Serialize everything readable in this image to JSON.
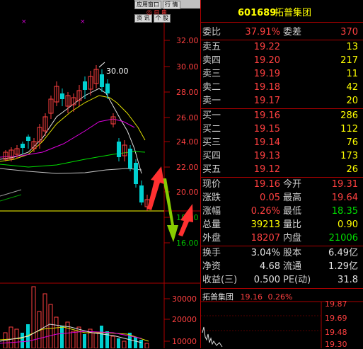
{
  "toolbar": {
    "buttons": [
      "应用窗口",
      "行 情",
      "资 讯",
      "个 股"
    ]
  },
  "price_axis": {
    "labels": [
      "32.00",
      "30.00",
      "28.00",
      "26.00",
      "24.00",
      "22.00",
      "20.00",
      "18.00",
      "16.00"
    ]
  },
  "volume_axis": {
    "labels": [
      "30000",
      "20000",
      "10000"
    ]
  },
  "annotation": {
    "peak_label": "30.00"
  },
  "quote": {
    "code": "601689",
    "name": "拓普集团",
    "committee": {
      "ratio_label": "委比",
      "ratio": "37.91%",
      "diff_label": "委差",
      "diff": "370"
    },
    "asks": [
      {
        "label": "卖五",
        "price": "19.22",
        "vol": "13"
      },
      {
        "label": "卖四",
        "price": "19.20",
        "vol": "217"
      },
      {
        "label": "卖三",
        "price": "19.19",
        "vol": "11"
      },
      {
        "label": "卖二",
        "price": "19.18",
        "vol": "42"
      },
      {
        "label": "卖一",
        "price": "19.17",
        "vol": "20"
      }
    ],
    "bids": [
      {
        "label": "买一",
        "price": "19.16",
        "vol": "286"
      },
      {
        "label": "买二",
        "price": "19.15",
        "vol": "112"
      },
      {
        "label": "买三",
        "price": "19.14",
        "vol": "76"
      },
      {
        "label": "买四",
        "price": "19.13",
        "vol": "173"
      },
      {
        "label": "买五",
        "price": "19.12",
        "vol": "26"
      }
    ],
    "stats": [
      {
        "l1": "现价",
        "v1": "19.16",
        "c1": "red",
        "l2": "今开",
        "v2": "19.31",
        "c2": "red"
      },
      {
        "l1": "涨跌",
        "v1": "0.05",
        "c1": "red",
        "l2": "最高",
        "v2": "19.64",
        "c2": "red"
      },
      {
        "l1": "涨幅",
        "v1": "0.26%",
        "c1": "red",
        "l2": "最低",
        "v2": "18.35",
        "c2": "grn"
      },
      {
        "l1": "总量",
        "v1": "39213",
        "c1": "yel",
        "l2": "量比",
        "v2": "0.90",
        "c2": "yel"
      },
      {
        "l1": "外盘",
        "v1": "18207",
        "c1": "red",
        "l2": "内盘",
        "v2": "21006",
        "c2": "grn"
      }
    ],
    "fundamentals": [
      {
        "l1": "换手",
        "v1": "3.04%",
        "l2": "股本",
        "v2": "6.49亿"
      },
      {
        "l1": "净资",
        "v1": "4.68",
        "l2": "流通",
        "v2": "1.29亿"
      },
      {
        "l1": "收益(三)",
        "v1": "0.500",
        "l2": "PE(动)",
        "v2": "31.8"
      }
    ],
    "mini_chart": {
      "name": "拓普集团",
      "price": "19.16",
      "pct": "0.26%",
      "axis": [
        "19.87",
        "19.69",
        "19.48",
        "19.30"
      ]
    }
  },
  "colors": {
    "up": "#ff4040",
    "down": "#00e000",
    "vol": "#ffff00",
    "frame": "#aa0000"
  }
}
